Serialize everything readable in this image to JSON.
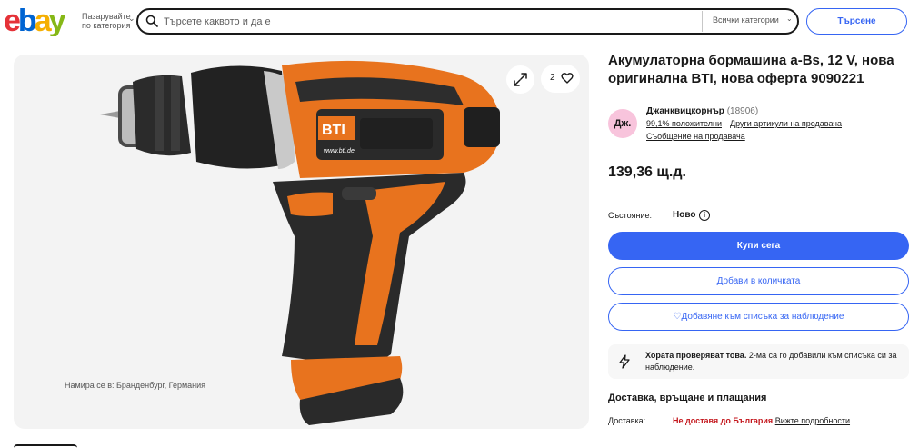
{
  "header": {
    "logo_text": "ebay",
    "shop_by_line1": "Пазарувайте",
    "shop_by_line2": "по категория",
    "search_placeholder": "Търсете каквото и да е",
    "category_label": "Всички категории",
    "search_button": "Търсене"
  },
  "gallery": {
    "watch_count": "2",
    "brand_text": "BTI",
    "brand_url": "www.bti.de",
    "icons": [
      "expand-icon",
      "heart-icon"
    ]
  },
  "listing": {
    "title": "Акумулаторна бормашина a-Bs, 12 V, нова оригинална BTI, нова оферта 9090221",
    "seller": {
      "avatar_initials": "Дж.",
      "name": "Джанквицкорнър",
      "feedback_count": "(18906)",
      "positive": "99,1% положителни",
      "other_items": "Други артикули на продавача",
      "contact": "Съобщение на продавача"
    },
    "price": "139,36 щ.д.",
    "condition_label": "Състояние:",
    "condition_value": "Ново",
    "buy_now": "Купи сега",
    "add_to_cart": "Добави в количката",
    "add_to_watchlist": "♡Добавяне към списъка за наблюдение",
    "promo_bold": "Хората проверяват това.",
    "promo_rest": " 2-ма са го добавили към списъка си за наблюдение.",
    "shipping_heading": "Доставка, връщане и плащания",
    "shipping_label": "Доставка:",
    "shipping_value": "Не доставя до България",
    "shipping_link": "Вижте подробности",
    "location": "Намира се в: Бранденбург, Германия"
  },
  "colors": {
    "ebay_red": "#e53238",
    "ebay_blue": "#0064d2",
    "ebay_yellow": "#f5af02",
    "ebay_green": "#86b817",
    "action_blue": "#3665f3",
    "drill_orange": "#e8731e"
  }
}
